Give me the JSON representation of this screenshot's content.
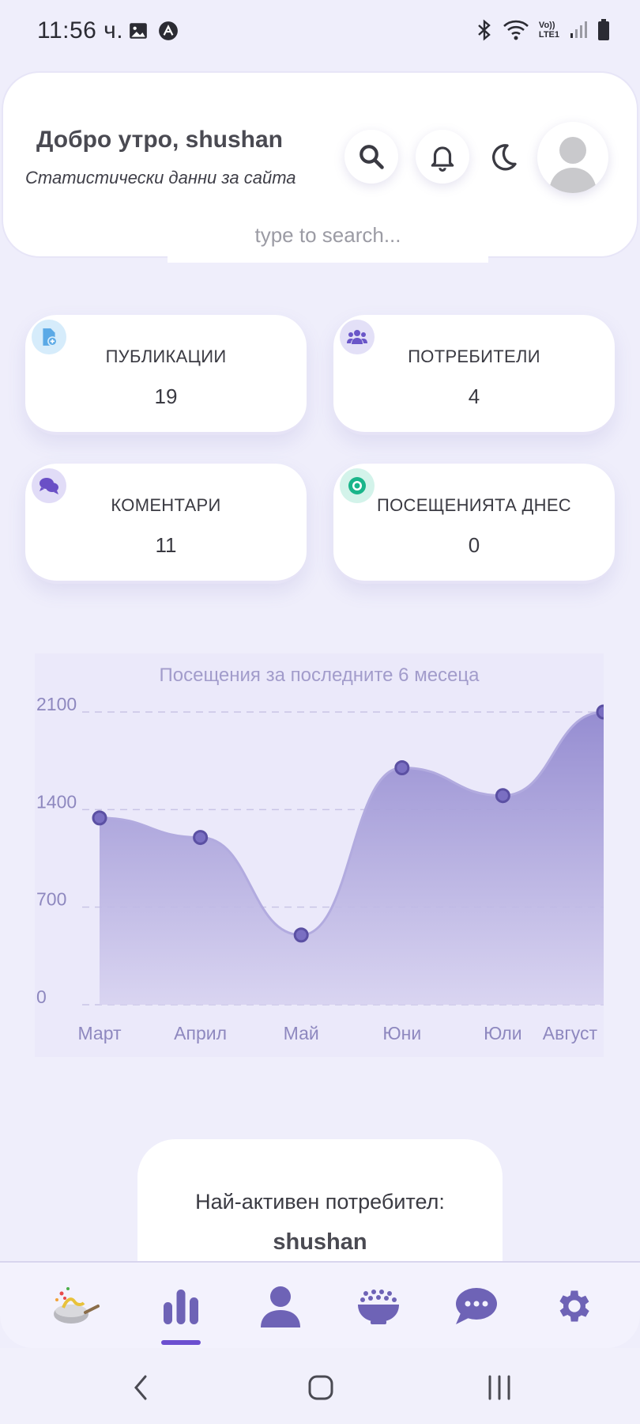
{
  "status_bar": {
    "time": "11:56 ч.",
    "icons_left": [
      "image-icon",
      "app-a-icon"
    ],
    "icons_right": [
      "bluetooth-icon",
      "wifi-icon",
      "volte-lte-icon",
      "signal-icon",
      "battery-icon"
    ],
    "volte_label": "Vo))",
    "lte_label": "LTE1"
  },
  "header": {
    "greeting": "Добро утро, shushan",
    "subtitle": "Статистически данни за сайта",
    "search_placeholder": "type to search..."
  },
  "stats": [
    {
      "label": "ПУБЛИКАЦИИ",
      "value": "19",
      "icon": "document-add-icon",
      "icon_bg": "#d6ecfb",
      "icon_color": "#5aa9e6"
    },
    {
      "label": "ПОТРЕБИТЕЛИ",
      "value": "4",
      "icon": "users-icon",
      "icon_bg": "#e3e0f7",
      "icon_color": "#6a56c8"
    },
    {
      "label": "КОМЕНТАРИ",
      "value": "11",
      "icon": "comments-icon",
      "icon_bg": "#e1dcf7",
      "icon_color": "#6a4fc6"
    },
    {
      "label": "ПОСЕЩЕНИЯТА ДНЕС",
      "value": "0",
      "icon": "eye-icon",
      "icon_bg": "#d3f3ea",
      "icon_color": "#19b58a"
    }
  ],
  "chart_data": {
    "type": "area",
    "title": "Посещения за последните 6 месеца",
    "categories": [
      "Март",
      "Април",
      "Май",
      "Юни",
      "Юли",
      "Август"
    ],
    "values": [
      1340,
      1200,
      500,
      1700,
      1500,
      2100
    ],
    "yticks": [
      0,
      700,
      1400,
      2100
    ],
    "ylim": [
      0,
      2100
    ],
    "grid": true,
    "line_color": "#6e63b6",
    "fill_color": "#9d94d4"
  },
  "most_active": {
    "label": "Най-активен потребител:",
    "name": "shushan"
  },
  "bottom_nav": {
    "items": [
      "chef-logo-icon",
      "stats-icon",
      "user-icon",
      "dishes-icon",
      "chat-icon",
      "settings-icon"
    ],
    "active": "stats-icon",
    "accent": "#6e63b6"
  },
  "system_nav": [
    "back-icon",
    "home-icon",
    "recents-icon"
  ]
}
